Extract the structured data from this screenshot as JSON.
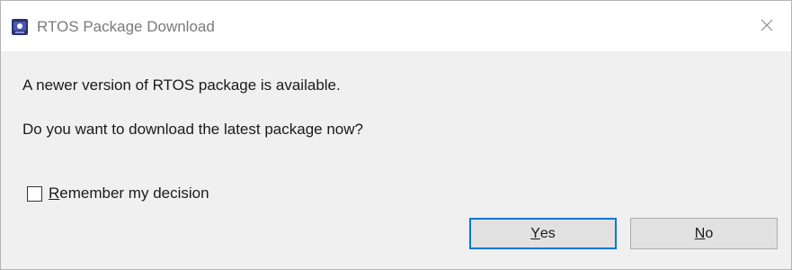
{
  "window": {
    "title": "RTOS Package Download",
    "app_icon": "eclipse-ide-icon",
    "close_icon": "close-icon"
  },
  "message": {
    "line1": "A newer version of RTOS package is available.",
    "line2": "Do you want to download the latest package now?"
  },
  "remember": {
    "label_mnemonic": "R",
    "label_rest": "emember my decision",
    "checked": false
  },
  "buttons": {
    "yes_mnemonic": "Y",
    "yes_rest": "es",
    "no_mnemonic": "N",
    "no_rest": "o"
  },
  "colors": {
    "default_button_border": "#0078d7",
    "dialog_background": "#f0f0f0"
  }
}
